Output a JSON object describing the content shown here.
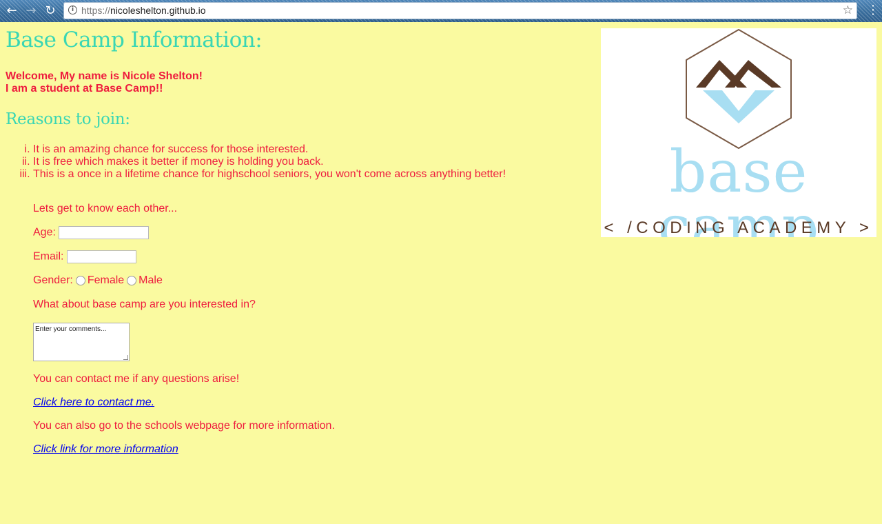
{
  "browser": {
    "back_icon": "←",
    "forward_icon": "→",
    "reload_icon": "↻",
    "url_scheme": "https://",
    "url_host": "nicoleshelton.github.io",
    "star_icon": "☆",
    "menu_icon": "⋮"
  },
  "page": {
    "title": "Base Camp Information:",
    "intro_line1": "Welcome, My name is Nicole Shelton!",
    "intro_line2": "I am a student at Base Camp!!",
    "reasons_heading": "Reasons to join:",
    "reasons": [
      "It is an amazing chance for success for those interested.",
      "It is free which makes it better if money is holding you back.",
      "This is a once in a lifetime chance for highschool seniors, you won't come across anything better!"
    ]
  },
  "form": {
    "intro": "Lets get to know each other...",
    "age_label": "Age:",
    "age_value": "",
    "email_label": "Email:",
    "email_value": "",
    "gender_label": "Gender:",
    "gender_options": [
      "Female",
      "Male"
    ],
    "interest_question": "What about base camp are you interested in?",
    "comments_placeholder": "Enter your comments...",
    "contact_text": "You can contact me if any questions arise!",
    "contact_link": "Click here to contact me.",
    "school_text": "You can also go to the schools webpage for more information.",
    "school_link": "Click link for more information"
  },
  "logo": {
    "wordmark": "base camp",
    "tagline": "< /CODING ACADEMY >"
  },
  "colors": {
    "background": "#fafaa0",
    "heading": "#3ad6b4",
    "text": "#ee1c3e",
    "link": "#0000ee",
    "logo_blue": "#a8def2",
    "logo_brown": "#5a3a26"
  }
}
